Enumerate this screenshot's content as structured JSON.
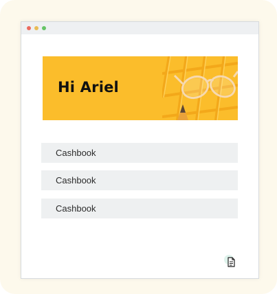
{
  "window": {
    "traffic_lights": [
      "red",
      "yellow",
      "green"
    ]
  },
  "banner": {
    "greeting": "Hi Ariel",
    "background_color": "#fbbd2b"
  },
  "list": {
    "items": [
      {
        "label": "Cashbook"
      },
      {
        "label": "Cashbook"
      },
      {
        "label": "Cashbook"
      }
    ]
  },
  "fab": {
    "icon": "document-icon"
  }
}
